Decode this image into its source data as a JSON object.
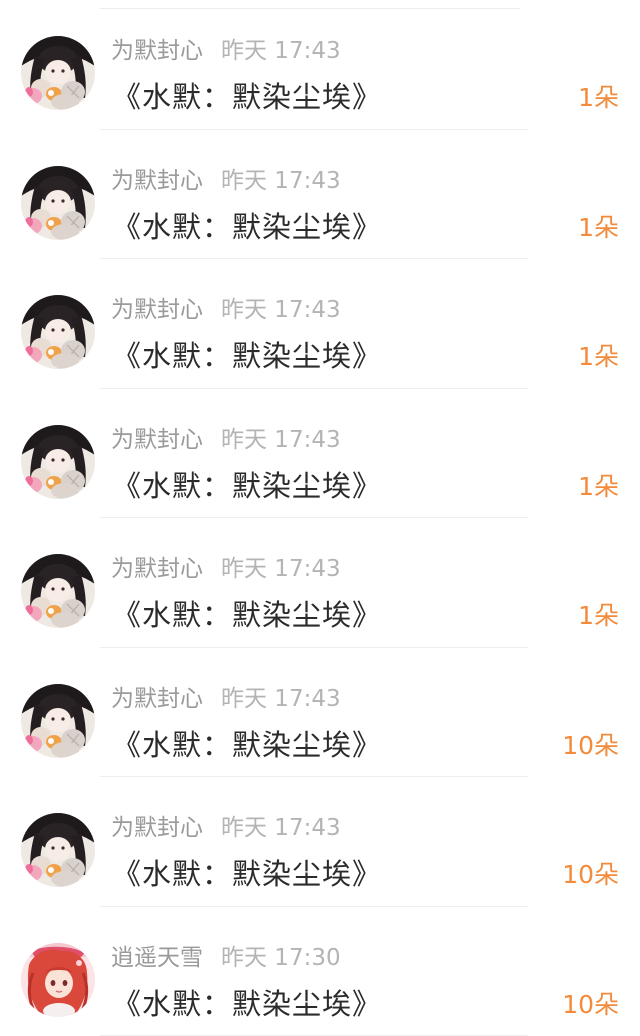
{
  "records": [
    {
      "username": "为默封心",
      "time": "昨天 17:43",
      "title": "《水默：默染尘埃》",
      "amount": "1朵",
      "avatar_icon": "anime-girl-dark-hair-avatar"
    },
    {
      "username": "为默封心",
      "time": "昨天 17:43",
      "title": "《水默：默染尘埃》",
      "amount": "1朵",
      "avatar_icon": "anime-girl-dark-hair-avatar"
    },
    {
      "username": "为默封心",
      "time": "昨天 17:43",
      "title": "《水默：默染尘埃》",
      "amount": "1朵",
      "avatar_icon": "anime-girl-dark-hair-avatar"
    },
    {
      "username": "为默封心",
      "time": "昨天 17:43",
      "title": "《水默：默染尘埃》",
      "amount": "1朵",
      "avatar_icon": "anime-girl-dark-hair-avatar"
    },
    {
      "username": "为默封心",
      "time": "昨天 17:43",
      "title": "《水默：默染尘埃》",
      "amount": "1朵",
      "avatar_icon": "anime-girl-dark-hair-avatar"
    },
    {
      "username": "为默封心",
      "time": "昨天 17:43",
      "title": "《水默：默染尘埃》",
      "amount": "10朵",
      "avatar_icon": "anime-girl-dark-hair-avatar"
    },
    {
      "username": "为默封心",
      "time": "昨天 17:43",
      "title": "《水默：默染尘埃》",
      "amount": "10朵",
      "avatar_icon": "anime-girl-dark-hair-avatar"
    },
    {
      "username": "逍遥天雪",
      "time": "昨天 17:30",
      "title": "《水默：默染尘埃》",
      "amount": "10朵",
      "avatar_icon": "anime-girl-red-hair-avatar"
    }
  ],
  "colors": {
    "username": "#9a9a9a",
    "time": "#b4b4b4",
    "title": "#2b2b2b",
    "amount": "#f28b3c",
    "divider": "#efefef"
  }
}
